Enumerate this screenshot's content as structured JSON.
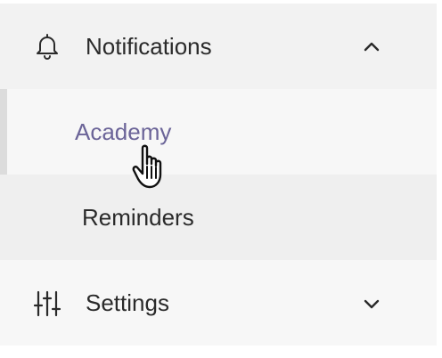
{
  "nav": {
    "notifications": {
      "label": "Notifications",
      "icon": "bell-icon",
      "expanded": true,
      "children": [
        {
          "label": "Academy",
          "active": true
        },
        {
          "label": "Reminders",
          "active": false
        }
      ]
    },
    "settings": {
      "label": "Settings",
      "icon": "sliders-icon",
      "expanded": false
    }
  },
  "colors": {
    "active_text": "#6b6498",
    "text": "#2a2a2a",
    "header_bg": "#f2f2f2",
    "active_bg": "#f7f7f7",
    "item_bg": "#efefef"
  }
}
